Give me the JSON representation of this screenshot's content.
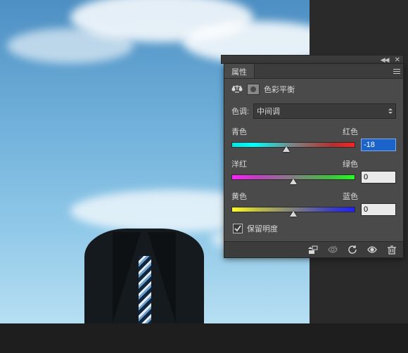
{
  "panel": {
    "tab": "属性",
    "title": "色彩平衡",
    "tone_label": "色调:",
    "tone_value": "中间调",
    "sliders": [
      {
        "left": "青色",
        "right": "红色",
        "value": "-18",
        "pos": 44,
        "grad": "grad-cr",
        "focused": true
      },
      {
        "left": "洋红",
        "right": "绿色",
        "value": "0",
        "pos": 50,
        "grad": "grad-mg",
        "focused": false
      },
      {
        "left": "黄色",
        "right": "蓝色",
        "value": "0",
        "pos": 50,
        "grad": "grad-yb",
        "focused": false
      }
    ],
    "preserve_label": "保留明度",
    "preserve_checked": true
  },
  "icons": {
    "balance": "balance-icon",
    "mask": "mask-icon",
    "clip": "clip-icon",
    "view_prev": "view-previous-icon",
    "reset": "reset-icon",
    "visibility": "eye-icon",
    "trash": "trash-icon"
  }
}
